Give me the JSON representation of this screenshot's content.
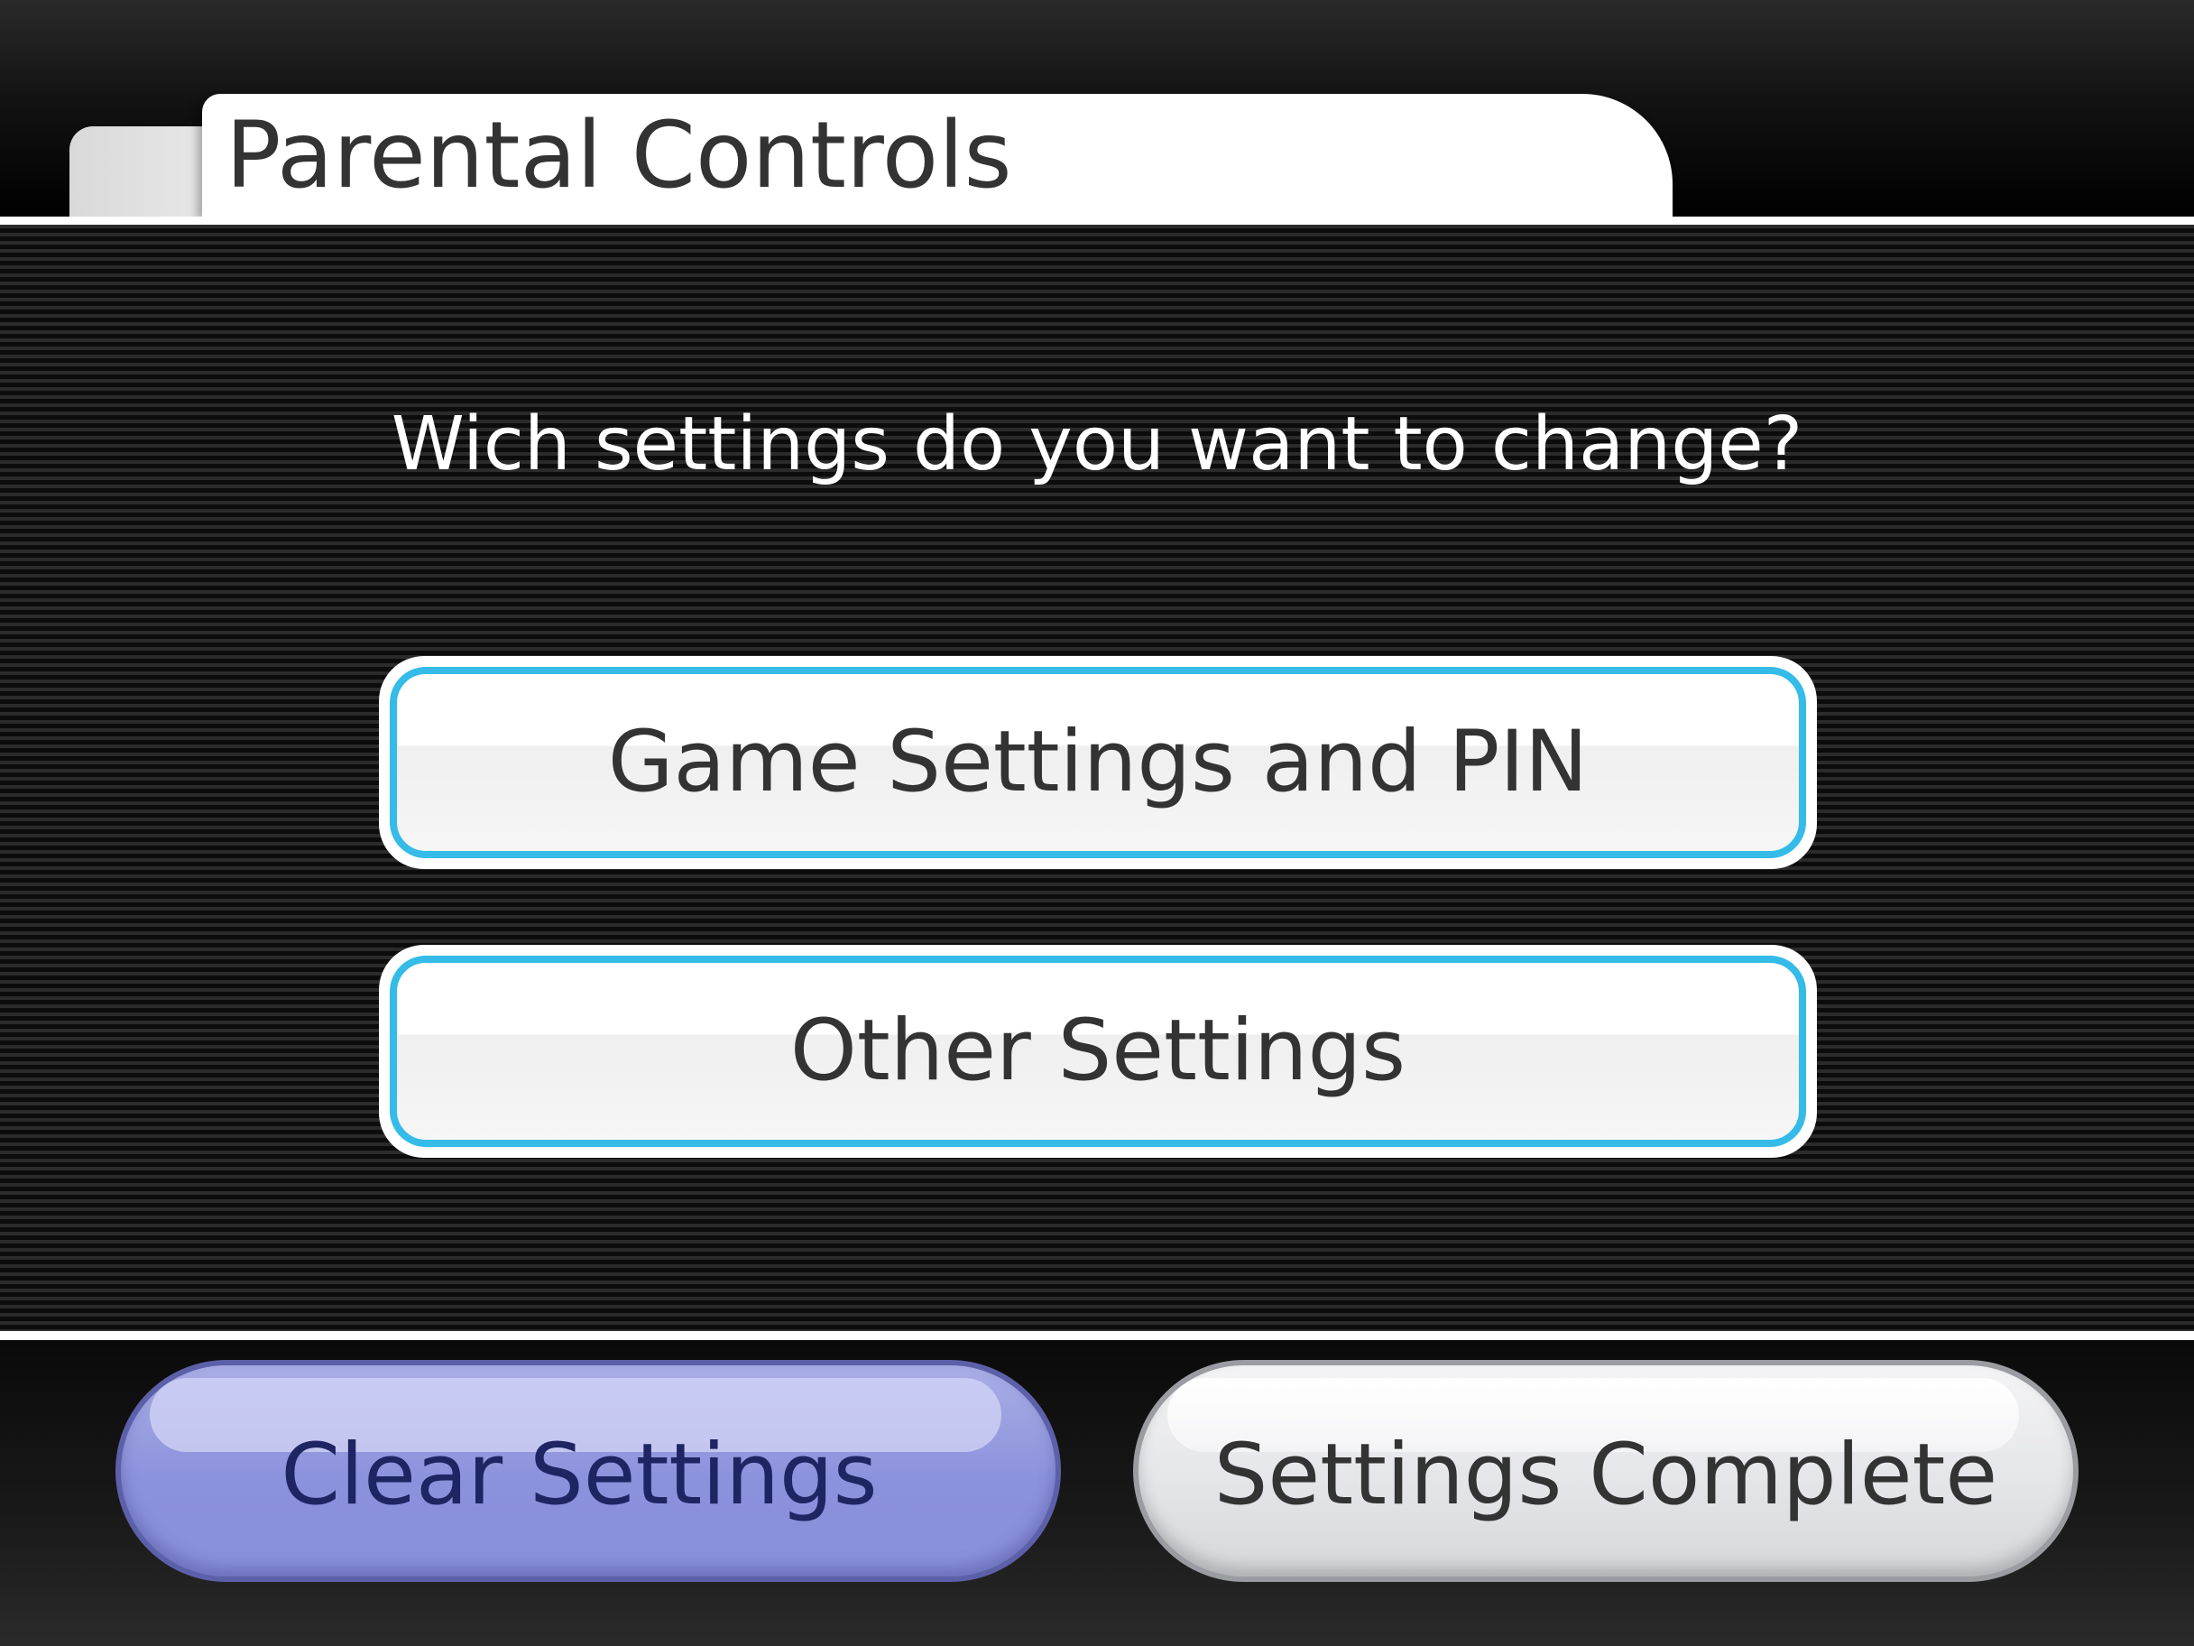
{
  "header": {
    "title": "Parental Controls"
  },
  "main": {
    "question": "Wich settings do you want to change?",
    "options": [
      {
        "label": "Game Settings and PIN"
      },
      {
        "label": "Other Settings"
      }
    ]
  },
  "footer": {
    "clear_label": "Clear Settings",
    "complete_label": "Settings Complete"
  },
  "colors": {
    "option_border": "#34bbe8",
    "clear_button": "#8c91dc",
    "complete_button": "#e3e4e8",
    "text_dark": "#333333",
    "background": "#000000"
  }
}
